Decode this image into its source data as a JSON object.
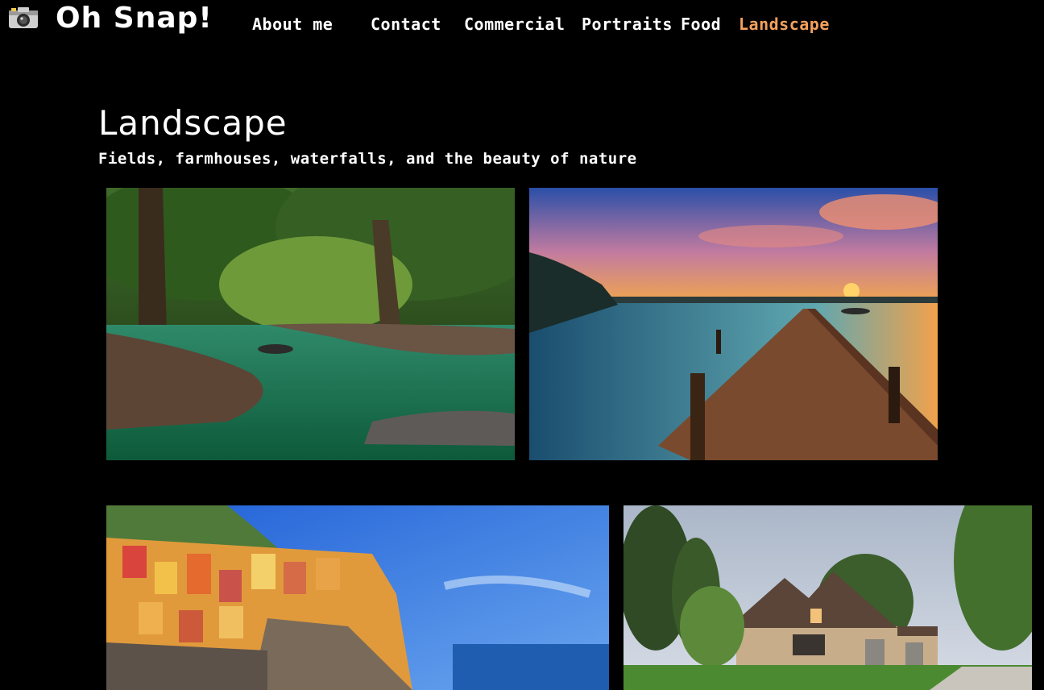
{
  "site": {
    "name": "Oh Snap!",
    "logo_icon": "camera-icon"
  },
  "nav": {
    "items": [
      {
        "label": "About me",
        "active": false
      },
      {
        "label": "Contact",
        "active": false
      },
      {
        "label": "Commercial",
        "active": false
      },
      {
        "label": "Portraits",
        "active": false
      },
      {
        "label": "Food",
        "active": false
      },
      {
        "label": "Landscape",
        "active": true
      }
    ],
    "active_color": "#f4a15d"
  },
  "page": {
    "title": "Landscape",
    "subtitle": "Fields, farmhouses, waterfalls, and the beauty of nature"
  },
  "gallery": {
    "photos": [
      {
        "subject": "forest river with green water and trees"
      },
      {
        "subject": "wooden pier on a lake at sunset"
      },
      {
        "subject": "colorful cliffside village by the sea"
      },
      {
        "subject": "stone house with lawn and trees"
      }
    ]
  },
  "colors": {
    "background": "#000000",
    "text": "#ffffff",
    "accent": "#f4a15d"
  }
}
